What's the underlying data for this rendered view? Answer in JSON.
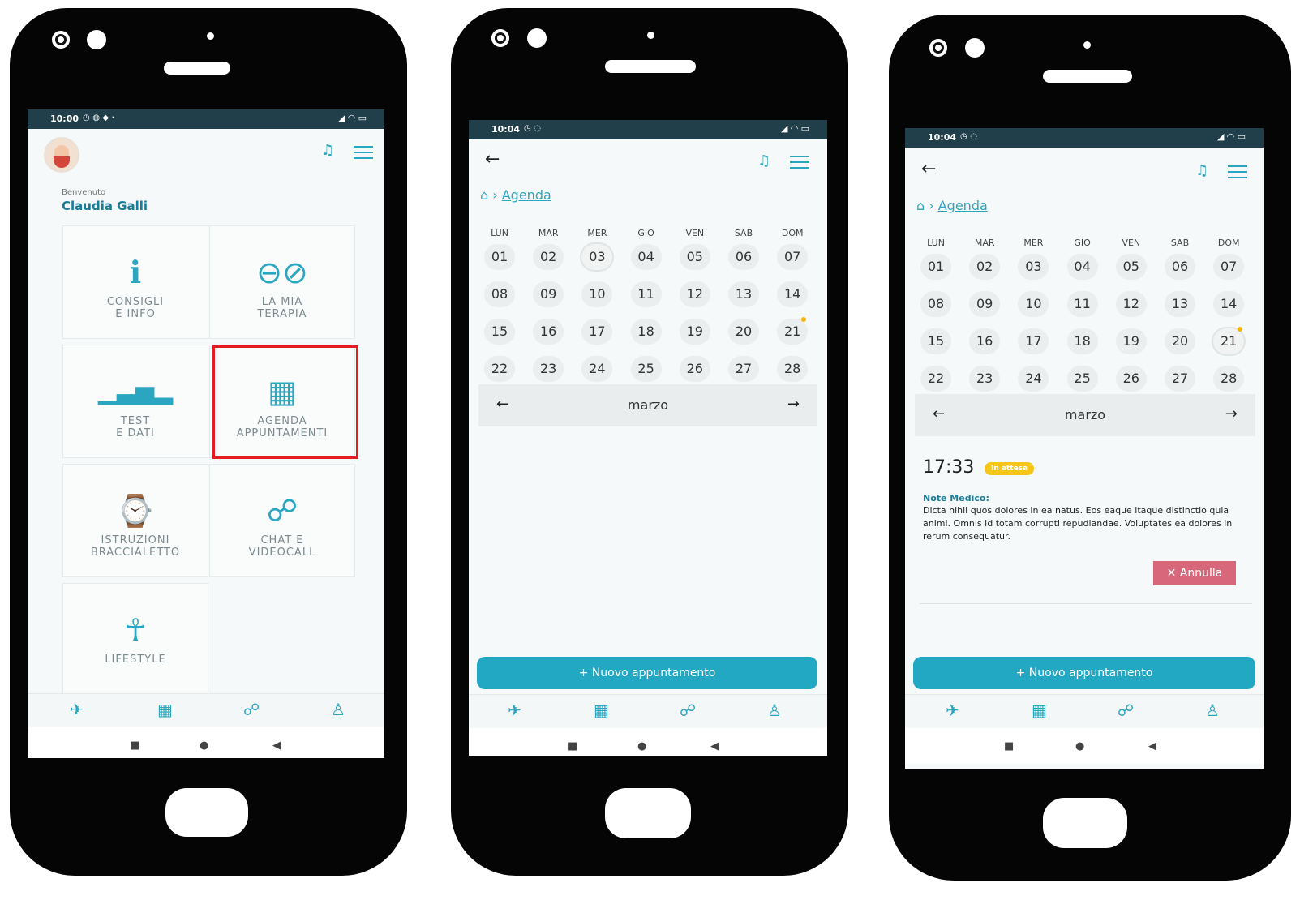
{
  "phone1": {
    "status_time": "10:00",
    "welcome": "Benvenuto",
    "user_name": "Claudia Galli",
    "tiles": [
      {
        "line1": "CONSIGLI",
        "line2": "E INFO",
        "icon": "info-icon"
      },
      {
        "line1": "LA MIA",
        "line2": "TERAPIA",
        "icon": "pill-icon"
      },
      {
        "line1": "TEST",
        "line2": "E DATI",
        "icon": "chart-icon"
      },
      {
        "line1": "AGENDA",
        "line2": "APPUNTAMENTI",
        "icon": "calendar-icon"
      },
      {
        "line1": "ISTRUZIONI",
        "line2": "BRACCIALETTO",
        "icon": "watch-icon"
      },
      {
        "line1": "CHAT E",
        "line2": "VIDEOCALL",
        "icon": "chat-icon"
      },
      {
        "line1": "LIFESTYLE",
        "line2": "",
        "icon": "person-icon"
      }
    ],
    "highlighted_tile": "AGENDA APPUNTAMENTI"
  },
  "phone2": {
    "status_time": "10:04",
    "breadcrumb": "Agenda",
    "weekdays": [
      "LUN",
      "MAR",
      "MER",
      "GIO",
      "VEN",
      "SAB",
      "DOM"
    ],
    "days": [
      "01",
      "02",
      "03",
      "04",
      "05",
      "06",
      "07",
      "08",
      "09",
      "10",
      "11",
      "12",
      "13",
      "14",
      "15",
      "16",
      "17",
      "18",
      "19",
      "20",
      "21",
      "22",
      "23",
      "24",
      "25",
      "26",
      "27",
      "28"
    ],
    "month": "marzo",
    "new_button": "+ Nuovo appuntamento"
  },
  "phone3": {
    "status_time": "10:04",
    "breadcrumb": "Agenda",
    "month": "marzo",
    "appointment_time": "17:33",
    "status_badge": "In attesa",
    "note_label": "Note Medico:",
    "note_text": "Dicta nihil quos dolores in ea natus. Eos eaque itaque distinctio quia animi. Omnis id totam corrupti repudiandae. Voluptates ea dolores in rerum consequatur.",
    "cancel_button": "✕  Annulla",
    "new_button": "+ Nuovo appuntamento"
  },
  "colors": {
    "accent": "#2aa6c0",
    "status_bar": "#203f4a",
    "highlight": "#e41c24",
    "badge": "#f5c518",
    "cancel": "#d9677b"
  }
}
